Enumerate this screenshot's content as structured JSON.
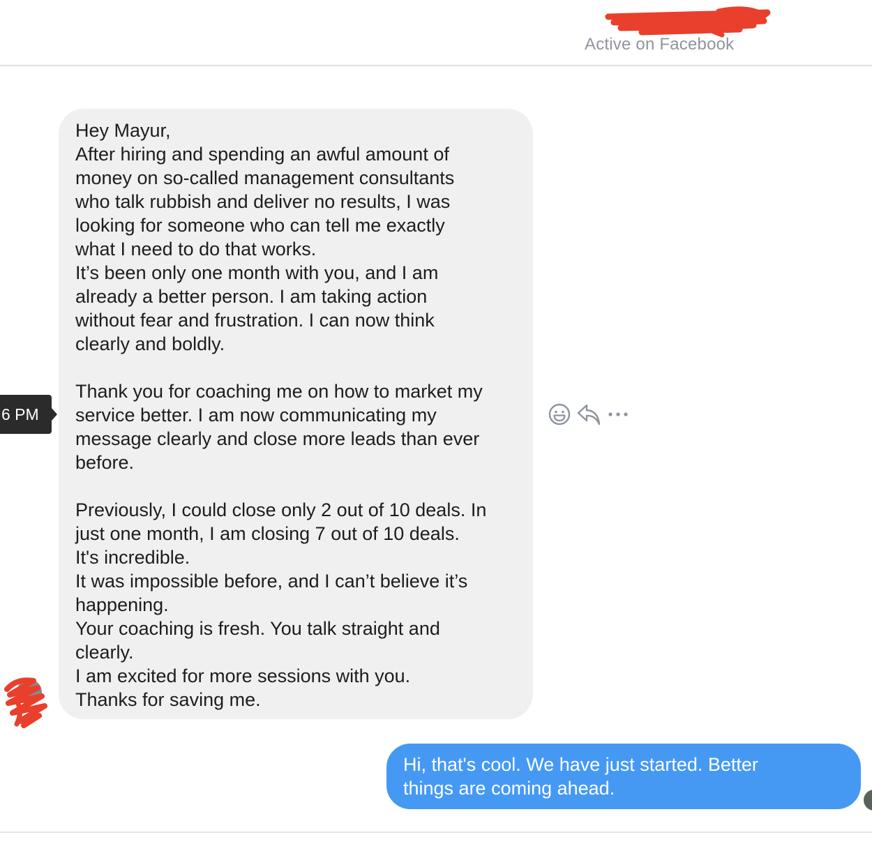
{
  "header": {
    "status": "Active on Facebook"
  },
  "thread": {
    "incoming": {
      "timestamp": "6 PM",
      "lines": [
        "Hey Mayur,",
        "After hiring and spending an awful amount of",
        "money on so-called management consultants",
        "who talk rubbish and deliver no results, I was",
        "looking for someone who can tell me exactly",
        "what I need to do that works.",
        "It’s been only one month with you, and I am",
        "already a better person. I am taking action",
        "without fear and frustration. I can now think",
        "clearly and boldly.",
        "",
        "Thank you for coaching me on how to market my",
        "service better. I am now communicating my",
        "message clearly and close more leads than ever",
        "before.",
        "",
        "Previously, I could close only 2 out of 10 deals. In",
        "just one month, I am closing 7 out of 10 deals.",
        "It's incredible.",
        "It was impossible before, and I can’t believe it’s",
        "happening.",
        "Your coaching is fresh. You talk straight and",
        "clearly.",
        "I am excited for more sessions with you.",
        "Thanks for saving me."
      ]
    },
    "outgoing": {
      "lines": [
        "Hi, that's cool. We have just started. Better",
        "things are coming ahead."
      ]
    }
  },
  "icons": {
    "react": "emoji-react-icon",
    "reply": "reply-icon",
    "more": "more-options-icon"
  },
  "colors": {
    "outgoing_bubble": "#4599f3",
    "incoming_bubble": "#f1f0f0",
    "tooltip": "#2b2b2b",
    "redaction": "#e8402c"
  }
}
